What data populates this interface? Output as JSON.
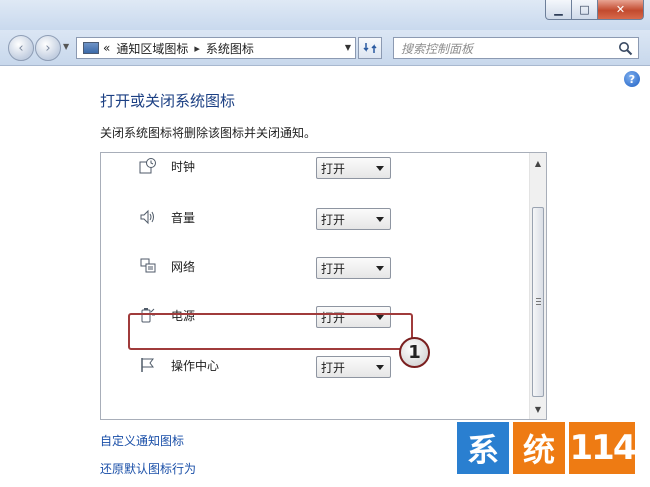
{
  "window": {
    "caption_buttons": {
      "minimize": "▁",
      "maximize": "□",
      "close": "✕"
    }
  },
  "navbar": {
    "back_icon": "‹",
    "forward_icon": "›",
    "breadcrumb_prefix": "«",
    "breadcrumb": [
      "通知区域图标",
      "系统图标"
    ],
    "breadcrumb_separator": "▸",
    "search_placeholder": "搜索控制面板"
  },
  "content": {
    "help": "?",
    "title": "打开或关闭系统图标",
    "description": "关闭系统图标将删除该图标并关闭通知。",
    "rows": [
      {
        "label": "时钟",
        "value": "打开",
        "icon": "clock-icon"
      },
      {
        "label": "音量",
        "value": "打开",
        "icon": "speaker-icon"
      },
      {
        "label": "网络",
        "value": "打开",
        "icon": "network-icon"
      },
      {
        "label": "电源",
        "value": "打开",
        "icon": "power-icon"
      },
      {
        "label": "操作中心",
        "value": "打开",
        "icon": "flag-icon"
      }
    ],
    "links": [
      "自定义通知图标",
      "还原默认图标行为"
    ],
    "callout": "1"
  },
  "watermark": {
    "chars": [
      "系",
      "统",
      "114"
    ]
  },
  "colors": {
    "title_blue": "#1b3f83",
    "link_blue": "#1a4fa8",
    "highlight_red": "#a03b3b",
    "wm_blue": "#2a7fd0",
    "wm_orange": "#ee7b13"
  }
}
